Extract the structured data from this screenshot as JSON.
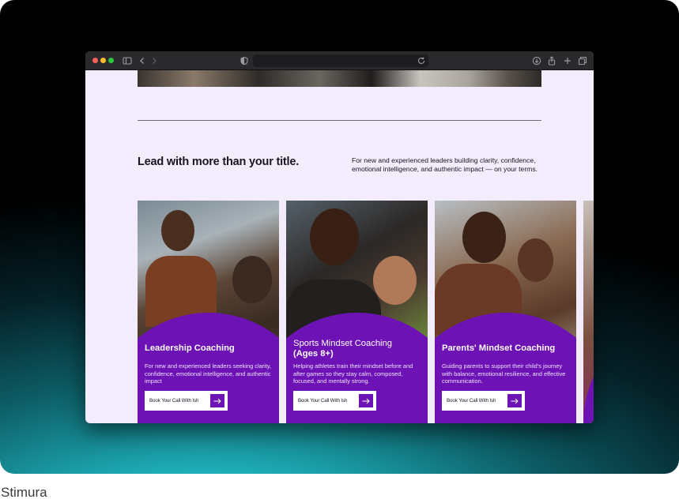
{
  "caption": "Stimura",
  "browser": {
    "toolbar_icons": [
      "sidebar-icon",
      "back-icon",
      "forward-icon",
      "shield-icon",
      "reload-icon",
      "download-icon",
      "share-icon",
      "new-tab-icon",
      "tabs-icon"
    ]
  },
  "section": {
    "headline_prefix": "Lead with more than your ",
    "headline_emphasis": "title.",
    "intro": "For new and experienced leaders building clarity, confidence, emotional intelligence, and authentic impact — on your terms."
  },
  "cards": [
    {
      "title": "Leadership Coaching",
      "subtitle": "",
      "description": "For new and experienced leaders seeking clarity, confidence, emotional intelligence, and authentic impact",
      "cta": "Book Your Call With Ish"
    },
    {
      "title": "Sports Mindset Coaching",
      "subtitle": "(Ages 8+)",
      "description": "Helping athletes train their mindset before and after games so they stay calm, composed, focused, and mentally strong.",
      "cta": "Book Your Call With Ish"
    },
    {
      "title": "Parents' Mindset Coaching",
      "subtitle": "",
      "description": "Guiding parents to support their child's journey with balance, emotional resilience, and effective communication.",
      "cta": "Book Your Call With Ish"
    }
  ],
  "colors": {
    "accent": "#6d12b5",
    "page_background": "#f3ecfd"
  }
}
